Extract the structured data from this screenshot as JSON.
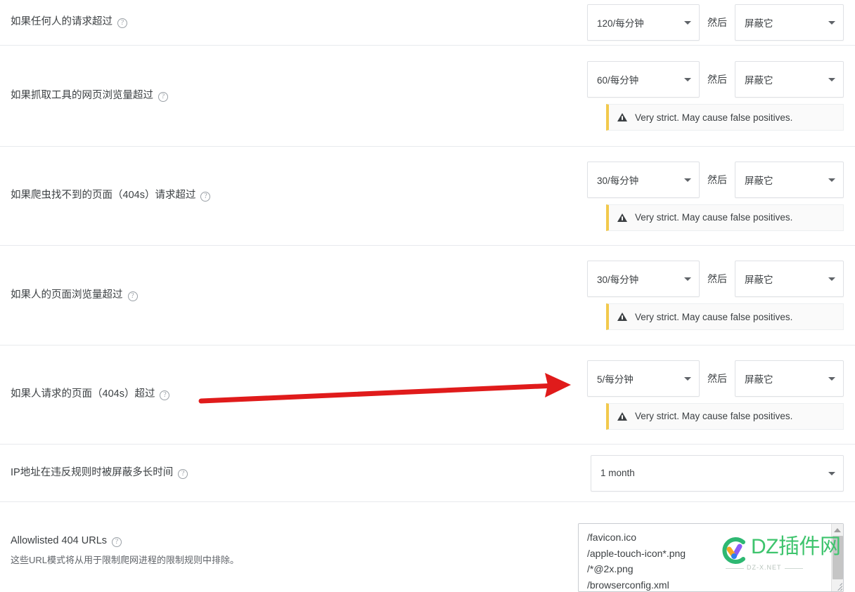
{
  "rows": [
    {
      "label": "如果任何人的请求超过",
      "help": "?",
      "rate": "120/每分钟",
      "then": "然后",
      "action": "屏蔽它",
      "warning": null
    },
    {
      "label": "如果抓取工具的网页浏览量超过",
      "help": "?",
      "rate": "60/每分钟",
      "then": "然后",
      "action": "屏蔽它",
      "warning": "Very strict. May cause false positives."
    },
    {
      "label": "如果爬虫找不到的页面（404s）请求超过",
      "help": "?",
      "rate": "30/每分钟",
      "then": "然后",
      "action": "屏蔽它",
      "warning": "Very strict. May cause false positives."
    },
    {
      "label": "如果人的页面浏览量超过",
      "help": "?",
      "rate": "30/每分钟",
      "then": "然后",
      "action": "屏蔽它",
      "warning": "Very strict. May cause false positives."
    },
    {
      "label": "如果人请求的页面（404s）超过",
      "help": "?",
      "rate": "5/每分钟",
      "then": "然后",
      "action": "屏蔽它",
      "warning": "Very strict. May cause false positives."
    }
  ],
  "block_duration": {
    "label": "IP地址在违反规则时被屏蔽多长时间",
    "help": "?",
    "value": "1 month"
  },
  "allowlist": {
    "label": "Allowlisted 404 URLs",
    "help": "?",
    "description": "这些URL模式将从用于限制爬网进程的限制规则中排除。",
    "value": "/favicon.ico\n/apple-touch-icon*.png\n/*@2x.png\n/browserconfig.xml"
  },
  "watermark": {
    "title": "DZ插件网",
    "subtitle": "DZ-X.NET"
  },
  "colors": {
    "warning_bar": "#f2c94c",
    "annotation_arrow": "#e01b1b",
    "separator": "#e8eaed",
    "watermark_green": "#3ec46d"
  }
}
